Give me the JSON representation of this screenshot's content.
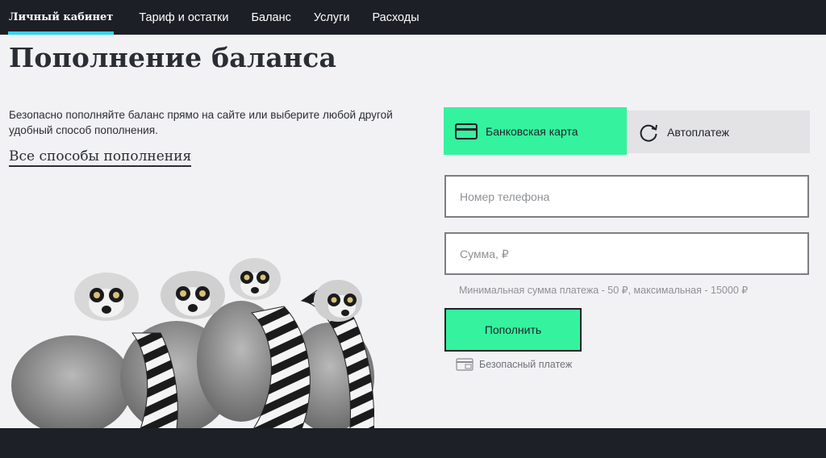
{
  "nav": {
    "items": [
      {
        "label": "Личный кабинет",
        "active": true
      },
      {
        "label": "Тариф и остатки",
        "active": false
      },
      {
        "label": "Баланс",
        "active": false
      },
      {
        "label": "Услуги",
        "active": false
      },
      {
        "label": "Расходы",
        "active": false
      }
    ]
  },
  "page": {
    "title": "Пополнение баланса",
    "intro": "Безопасно пополняйте баланс прямо на сайте или выберите любой другой удобный способ пополнения.",
    "all_methods_link": "Все способы пополнения"
  },
  "payment": {
    "tabs": [
      {
        "label": "Банковская карта",
        "icon": "credit-card-icon",
        "active": true
      },
      {
        "label": "Автоплатеж",
        "icon": "refresh-icon",
        "active": false
      }
    ],
    "phone_placeholder": "Номер телефона",
    "amount_placeholder": "Сумма, ₽",
    "limits_text": "Минимальная сумма платежа - 50 ₽, максимальная - 15000 ₽",
    "submit_label": "Пополнить",
    "secure_text": "Безопасный платеж"
  },
  "colors": {
    "accent_green": "#35f29e",
    "nav_bg": "#1c1f25",
    "nav_underline": "#2fd4f0",
    "page_bg": "#f2f2f4"
  }
}
